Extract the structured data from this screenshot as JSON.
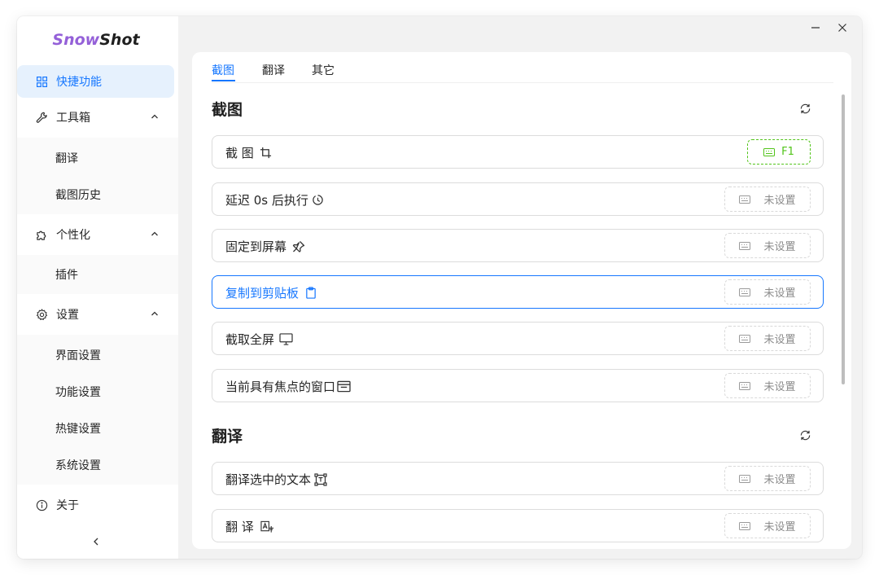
{
  "app": {
    "logo_part1": "Snow",
    "logo_part2": "Shot"
  },
  "sidebar": {
    "items": [
      {
        "label": "快捷功能",
        "icon": "grid-icon",
        "active": true
      },
      {
        "label": "工具箱",
        "icon": "wrench-icon",
        "expanded": true,
        "children": [
          "翻译",
          "截图历史"
        ]
      },
      {
        "label": "个性化",
        "icon": "puzzle-icon",
        "expanded": true,
        "children": [
          "插件"
        ]
      },
      {
        "label": "设置",
        "icon": "gear-icon",
        "expanded": true,
        "children": [
          "界面设置",
          "功能设置",
          "热键设置",
          "系统设置"
        ]
      },
      {
        "label": "关于",
        "icon": "info-icon"
      }
    ],
    "collapse_icon": "chevron-left-icon"
  },
  "window_controls": {
    "minimize_icon": "minimize-icon",
    "close_icon": "close-icon"
  },
  "tabs": [
    {
      "label": "截图",
      "active": true
    },
    {
      "label": "翻译"
    },
    {
      "label": "其它"
    }
  ],
  "sections": [
    {
      "title": "截图",
      "reset_icon": "reset-icon",
      "rows": [
        {
          "label": "截 图",
          "icon": "crop-icon",
          "hotkey": "F1",
          "hotkey_set": true
        },
        {
          "label": "延迟 0s 后执行",
          "icon": "timer-icon",
          "hotkey": "未设置"
        },
        {
          "label": "固定到屏幕",
          "icon": "pin-icon",
          "hotkey": "未设置"
        },
        {
          "label": "复制到剪贴板",
          "icon": "clipboard-icon",
          "hotkey": "未设置",
          "focused": true
        },
        {
          "label": "截取全屏",
          "icon": "monitor-icon",
          "hotkey": "未设置"
        },
        {
          "label": "当前具有焦点的窗口",
          "icon": "window-icon",
          "hotkey": "未设置"
        }
      ]
    },
    {
      "title": "翻译",
      "reset_icon": "reset-icon",
      "rows": [
        {
          "label": "翻译选中的文本",
          "icon": "text-select-icon",
          "hotkey": "未设置"
        },
        {
          "label": "翻 译",
          "icon": "translate-icon",
          "hotkey": "未设置"
        }
      ]
    }
  ],
  "colors": {
    "accent": "#1677ff",
    "success": "#52c41a",
    "logo_purple": "#9460d8"
  }
}
